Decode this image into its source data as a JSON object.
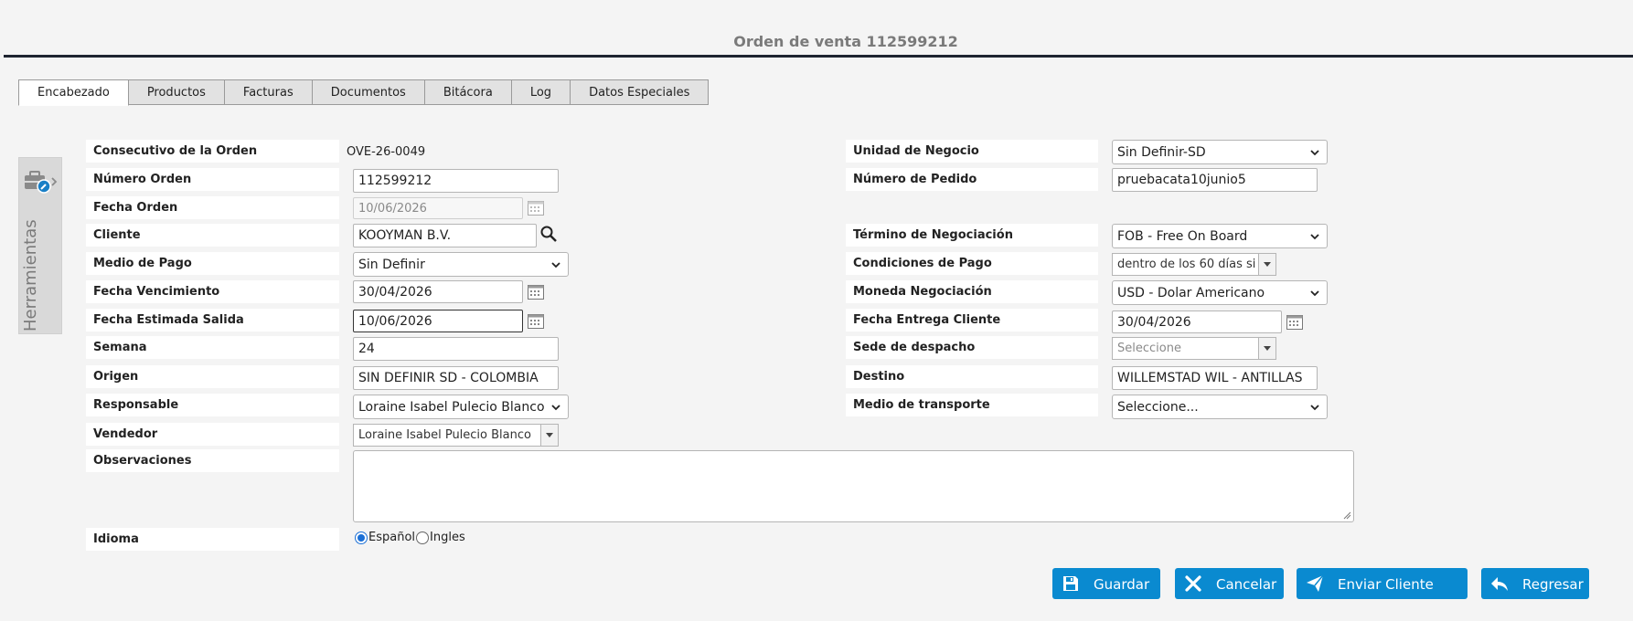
{
  "page": {
    "title": "Orden de venta 112599212"
  },
  "tabs": [
    "Encabezado",
    "Productos",
    "Facturas",
    "Documentos",
    "Bitácora",
    "Log",
    "Datos Especiales"
  ],
  "tools": {
    "label": "Herramientas"
  },
  "left": {
    "consecutivo": {
      "label": "Consecutivo de la Orden",
      "value": "OVE-26-0049"
    },
    "numero_orden": {
      "label": "Número Orden",
      "value": "112599212"
    },
    "fecha_orden": {
      "label": "Fecha Orden",
      "value": "10/06/2026"
    },
    "cliente": {
      "label": "Cliente",
      "value": "KOOYMAN B.V."
    },
    "medio_pago": {
      "label": "Medio de Pago",
      "value": "Sin Definir"
    },
    "fecha_vencimiento": {
      "label": "Fecha Vencimiento",
      "value": "30/04/2026"
    },
    "fecha_estimada_salida": {
      "label": "Fecha Estimada Salida",
      "value": "10/06/2026"
    },
    "semana": {
      "label": "Semana",
      "value": "24"
    },
    "origen": {
      "label": "Origen",
      "value": "SIN DEFINIR SD - COLOMBIA"
    },
    "responsable": {
      "label": "Responsable",
      "value": "Loraine Isabel Pulecio Blanco"
    },
    "vendedor": {
      "label": "Vendedor",
      "value": "Loraine Isabel Pulecio Blanco"
    },
    "observaciones": {
      "label": "Observaciones",
      "value": ""
    },
    "idioma": {
      "label": "Idioma",
      "options": [
        "Español",
        "Ingles"
      ],
      "selected": "Español"
    }
  },
  "right": {
    "unidad_negocio": {
      "label": "Unidad de Negocio",
      "value": "Sin Definir-SD"
    },
    "numero_pedido": {
      "label": "Número de Pedido",
      "value": "pruebacata10junio5"
    },
    "termino_negociacion": {
      "label": "Término de Negociación",
      "value": "FOB - Free On Board"
    },
    "condiciones_pago": {
      "label": "Condiciones de Pago",
      "value": "dentro de los 60 días si"
    },
    "moneda": {
      "label": "Moneda Negociación",
      "value": "USD - Dolar Americano"
    },
    "fecha_entrega": {
      "label": "Fecha Entrega Cliente",
      "value": "30/04/2026"
    },
    "sede_despacho": {
      "label": "Sede de despacho",
      "placeholder": "Seleccione"
    },
    "destino": {
      "label": "Destino",
      "value": "WILLEMSTAD WIL - ANTILLAS"
    },
    "medio_transporte": {
      "label": "Medio de transporte",
      "value": "Seleccione..."
    }
  },
  "actions": {
    "save": "Guardar",
    "cancel": "Cancelar",
    "send": "Enviar Cliente",
    "back": "Regresar"
  },
  "colors": {
    "primary": "#0a8ad0",
    "title_rule": "#1e2430"
  }
}
